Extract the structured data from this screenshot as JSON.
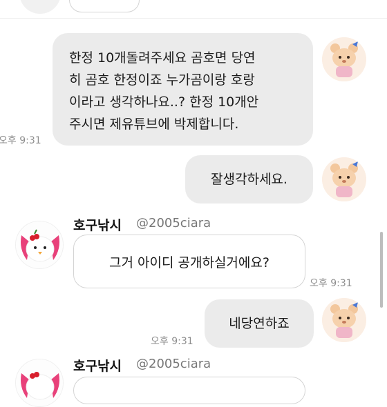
{
  "messages": {
    "m1": {
      "text": "한정 10개돌려주세요 곰호면 당연히 곰호 한정이죠 누가곰이랑 호랑이라고 생각하나요..? 한정 10개안주시면 제유튜브에 박제합니다.",
      "lines": [
        "한정 10개돌려주세요 곰호면 당연",
        "히 곰호 한정이죠 누가곰이랑 호랑",
        "이라고 생각하나요..? 한정 10개안",
        "주시면 제유튜브에 박제합니다."
      ],
      "time": "오후 9:31"
    },
    "m2": {
      "text": "잘생각하세요."
    },
    "m3": {
      "sender_name": "호구낚시",
      "sender_handle": "@2005ciara",
      "text": "그거 아이디 공개하실거에요?",
      "time": "오후 9:31"
    },
    "m4": {
      "text": "네당연하죠",
      "time": "오후 9:31"
    },
    "m5": {
      "sender_name": "호구낚시",
      "sender_handle": "@2005ciara"
    }
  },
  "icons": {
    "my_avatar": "cartoon-bear-avatar",
    "other_avatar": "white-chick-avatar"
  },
  "colors": {
    "outgoing_bubble": "#ebebeb",
    "incoming_bubble_border": "#d4d4d4",
    "timestamp": "#8e8e8e"
  }
}
